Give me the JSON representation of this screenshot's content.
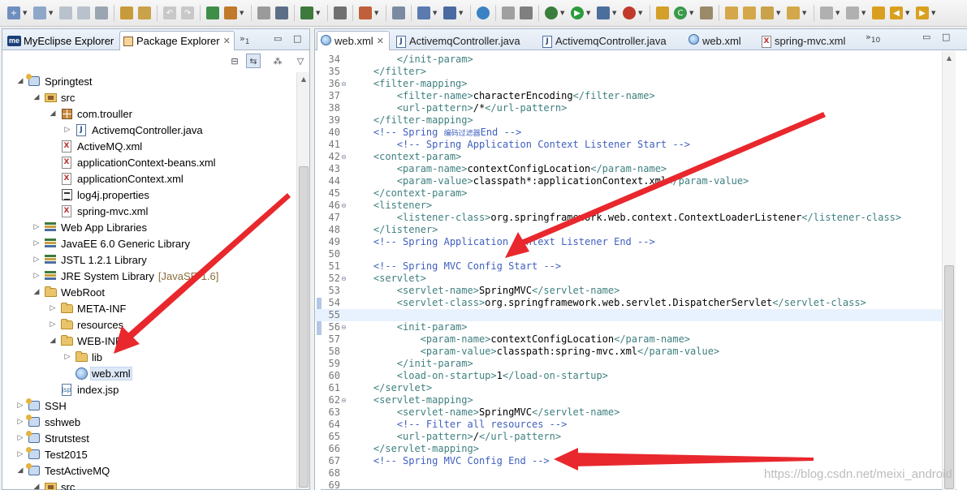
{
  "colors": {
    "arrow": "#e8282d",
    "selection": "#dde8f7",
    "current_line": "#e8f2fe"
  },
  "left_panel": {
    "tabs": [
      {
        "label": "MyEclipse Explorer",
        "icon": "myeclipse-icon"
      },
      {
        "label": "Package Explorer",
        "icon": "package-explorer-icon"
      }
    ],
    "overflow_count": "1"
  },
  "tree": [
    {
      "label": "Springtest",
      "icon": "project",
      "twisty": "open"
    },
    {
      "label": "src",
      "icon": "src",
      "twisty": "open"
    },
    {
      "label": "com.trouller",
      "icon": "package",
      "twisty": "open"
    },
    {
      "label": "ActivemqController.java",
      "icon": "java",
      "twisty": "closed"
    },
    {
      "label": "ActiveMQ.xml",
      "icon": "xml",
      "twisty": ""
    },
    {
      "label": "applicationContext-beans.xml",
      "icon": "xml",
      "twisty": ""
    },
    {
      "label": "applicationContext.xml",
      "icon": "xml",
      "twisty": ""
    },
    {
      "label": "log4j.properties",
      "icon": "props",
      "twisty": ""
    },
    {
      "label": "spring-mvc.xml",
      "icon": "xml",
      "twisty": ""
    },
    {
      "label": "Web App Libraries",
      "icon": "lib",
      "twisty": "closed"
    },
    {
      "label": "JavaEE 6.0 Generic Library",
      "icon": "lib",
      "twisty": "closed"
    },
    {
      "label": "JSTL 1.2.1 Library",
      "icon": "lib",
      "twisty": "closed"
    },
    {
      "label": "JRE System Library",
      "decoration": "[JavaSE-1.6]",
      "icon": "lib",
      "twisty": "closed"
    },
    {
      "label": "WebRoot",
      "icon": "folder",
      "twisty": "open"
    },
    {
      "label": "META-INF",
      "icon": "folder",
      "twisty": "closed"
    },
    {
      "label": "resources",
      "icon": "folder",
      "twisty": "closed"
    },
    {
      "label": "WEB-INF",
      "icon": "folder",
      "twisty": "open"
    },
    {
      "label": "lib",
      "icon": "folder",
      "twisty": "closed"
    },
    {
      "label": "web.xml",
      "icon": "web",
      "twisty": "",
      "selected": true
    },
    {
      "label": "index.jsp",
      "icon": "jsp",
      "twisty": ""
    },
    {
      "label": "SSH",
      "icon": "project",
      "twisty": "closed"
    },
    {
      "label": "sshweb",
      "icon": "project",
      "twisty": "closed"
    },
    {
      "label": "Strutstest",
      "icon": "project",
      "twisty": "closed"
    },
    {
      "label": "Test2015",
      "icon": "project",
      "twisty": "closed"
    },
    {
      "label": "TestActiveMQ",
      "icon": "project",
      "twisty": "open"
    },
    {
      "label": "src",
      "icon": "src",
      "twisty": "open"
    }
  ],
  "editor_tabs": [
    {
      "label": "web.xml",
      "icon": "web-xml-icon",
      "active": true
    },
    {
      "label": "ActivemqController.java",
      "icon": "java-file-icon"
    },
    {
      "label": "ActivemqController.java",
      "icon": "java-file-icon"
    },
    {
      "label": "web.xml",
      "icon": "web-xml-icon"
    },
    {
      "label": "spring-mvc.xml",
      "icon": "xml-file-icon"
    }
  ],
  "editor_overflow_count": "10",
  "code_lines": [
    {
      "n": "34",
      "fold": "",
      "parts": [
        [
          "t",
          "        </init-param>"
        ]
      ]
    },
    {
      "n": "35",
      "fold": "",
      "parts": [
        [
          "t",
          "    </filter>"
        ]
      ]
    },
    {
      "n": "36",
      "fold": "⊖",
      "parts": [
        [
          "t",
          "    <filter-mapping>"
        ]
      ]
    },
    {
      "n": "37",
      "fold": "",
      "parts": [
        [
          "t",
          "        <filter-name>"
        ],
        [
          "x",
          "characterEncoding"
        ],
        [
          "t",
          "</filter-name>"
        ]
      ]
    },
    {
      "n": "38",
      "fold": "",
      "parts": [
        [
          "t",
          "        <url-pattern>"
        ],
        [
          "x",
          "/*"
        ],
        [
          "t",
          "</url-pattern>"
        ]
      ]
    },
    {
      "n": "39",
      "fold": "",
      "parts": [
        [
          "t",
          "    </filter-mapping>"
        ]
      ]
    },
    {
      "n": "40",
      "fold": "",
      "parts": [
        [
          "c",
          "    <!-- Spring "
        ],
        [
          "k",
          "编码过滤器"
        ],
        [
          "c",
          "End -->"
        ]
      ]
    },
    {
      "n": "41",
      "fold": "",
      "parts": [
        [
          "c",
          "        <!-- Spring Application Context Listener Start -->"
        ]
      ]
    },
    {
      "n": "42",
      "fold": "⊖",
      "parts": [
        [
          "t",
          "    <context-param>"
        ]
      ]
    },
    {
      "n": "43",
      "fold": "",
      "parts": [
        [
          "t",
          "        <param-name>"
        ],
        [
          "x",
          "contextConfigLocation"
        ],
        [
          "t",
          "</param-name>"
        ]
      ]
    },
    {
      "n": "44",
      "fold": "",
      "parts": [
        [
          "t",
          "        <param-value>"
        ],
        [
          "x",
          "classpath*:applicationContext.xml"
        ],
        [
          "t",
          "</param-value>"
        ]
      ]
    },
    {
      "n": "45",
      "fold": "",
      "parts": [
        [
          "t",
          "    </context-param>"
        ]
      ]
    },
    {
      "n": "46",
      "fold": "⊖",
      "parts": [
        [
          "t",
          "    <listener>"
        ]
      ]
    },
    {
      "n": "47",
      "fold": "",
      "parts": [
        [
          "t",
          "        <listener-class>"
        ],
        [
          "x",
          "org.springframework.web.context.ContextLoaderListener"
        ],
        [
          "t",
          "</listener-class>"
        ]
      ]
    },
    {
      "n": "48",
      "fold": "",
      "parts": [
        [
          "t",
          "    </listener>"
        ]
      ]
    },
    {
      "n": "49",
      "fold": "",
      "parts": [
        [
          "c",
          "    <!-- Spring Application Context Listener End -->"
        ]
      ]
    },
    {
      "n": "50",
      "fold": "",
      "parts": []
    },
    {
      "n": "51",
      "fold": "",
      "parts": [
        [
          "c",
          "    <!-- Spring MVC Config Start -->"
        ]
      ]
    },
    {
      "n": "52",
      "fold": "⊖",
      "parts": [
        [
          "t",
          "    <servlet>"
        ]
      ]
    },
    {
      "n": "53",
      "fold": "",
      "parts": [
        [
          "t",
          "        <servlet-name>"
        ],
        [
          "x",
          "SpringMVC"
        ],
        [
          "t",
          "</servlet-name>"
        ]
      ]
    },
    {
      "n": "54",
      "fold": "",
      "parts": [
        [
          "t",
          "        <servlet-class>"
        ],
        [
          "x",
          "org.springframework.web.servlet.DispatcherServlet"
        ],
        [
          "t",
          "</servlet-class>"
        ]
      ]
    },
    {
      "n": "55",
      "fold": "",
      "parts": [],
      "current": true
    },
    {
      "n": "56",
      "fold": "⊖",
      "parts": [
        [
          "t",
          "        <init-param>"
        ]
      ]
    },
    {
      "n": "57",
      "fold": "",
      "parts": [
        [
          "t",
          "            <param-name>"
        ],
        [
          "x",
          "contextConfigLocation"
        ],
        [
          "t",
          "</param-name>"
        ]
      ]
    },
    {
      "n": "58",
      "fold": "",
      "parts": [
        [
          "t",
          "            <param-value>"
        ],
        [
          "x",
          "classpath:spring-mvc.xml"
        ],
        [
          "t",
          "</param-value>"
        ]
      ]
    },
    {
      "n": "59",
      "fold": "",
      "parts": [
        [
          "t",
          "        </init-param>"
        ]
      ]
    },
    {
      "n": "60",
      "fold": "",
      "parts": [
        [
          "t",
          "        <load-on-startup>"
        ],
        [
          "x",
          "1"
        ],
        [
          "t",
          "</load-on-startup>"
        ]
      ]
    },
    {
      "n": "61",
      "fold": "",
      "parts": [
        [
          "t",
          "    </servlet>"
        ]
      ]
    },
    {
      "n": "62",
      "fold": "⊖",
      "parts": [
        [
          "t",
          "    <servlet-mapping>"
        ]
      ]
    },
    {
      "n": "63",
      "fold": "",
      "parts": [
        [
          "t",
          "        <servlet-name>"
        ],
        [
          "x",
          "SpringMVC"
        ],
        [
          "t",
          "</servlet-name>"
        ]
      ]
    },
    {
      "n": "64",
      "fold": "",
      "parts": [
        [
          "c",
          "        <!-- Filter all resources -->"
        ]
      ]
    },
    {
      "n": "65",
      "fold": "",
      "parts": [
        [
          "t",
          "        <url-pattern>"
        ],
        [
          "x",
          "/"
        ],
        [
          "t",
          "</url-pattern>"
        ]
      ]
    },
    {
      "n": "66",
      "fold": "",
      "parts": [
        [
          "t",
          "    </servlet-mapping>"
        ]
      ]
    },
    {
      "n": "67",
      "fold": "",
      "parts": [
        [
          "c",
          "    <!-- Spring MVC Config End -->"
        ]
      ]
    },
    {
      "n": "68",
      "fold": "",
      "parts": []
    },
    {
      "n": "69",
      "fold": "",
      "parts": []
    }
  ],
  "watermark": "https://blog.csdn.net/meixi_android"
}
